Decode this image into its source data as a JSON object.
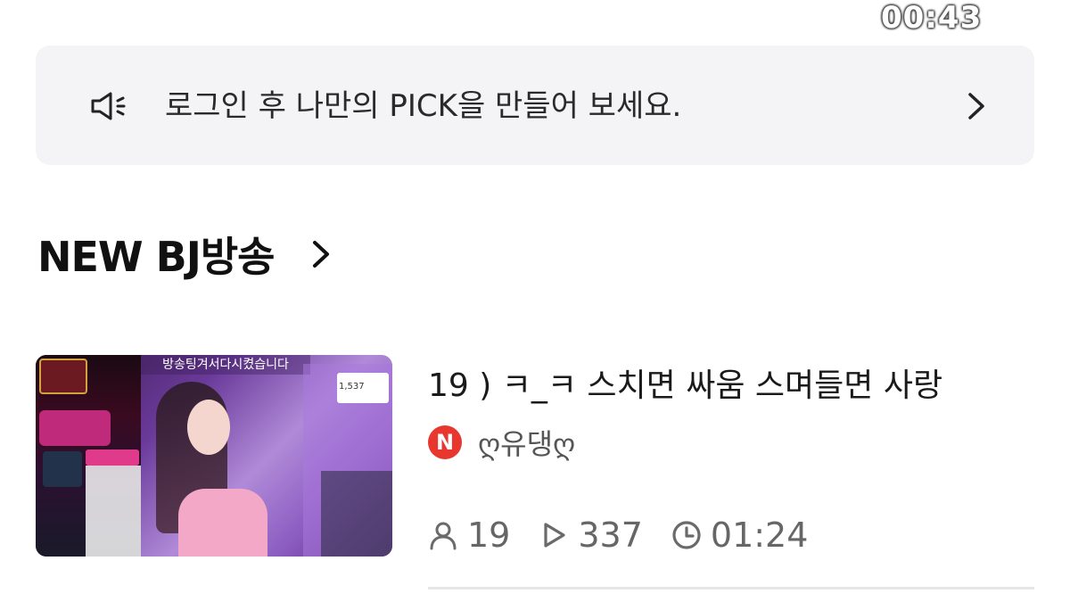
{
  "status": {
    "clock": "00:43"
  },
  "notice": {
    "text": "로그인 후 나만의 PICK을 만들어 보세요."
  },
  "section": {
    "title": "NEW BJ방송"
  },
  "broadcast": {
    "thumbnail_banner": "방송팅겨서다시켰습니다",
    "thumbnail_viewer_count": "1,537",
    "title": "19 ) ㅋ_ㅋ 스치면 싸움 스며들면 사랑",
    "author_badge": "N",
    "author": "ღ유댕ღ",
    "viewers": "19",
    "plays": "337",
    "duration": "01:24"
  },
  "icons": {
    "notice": "speaker-icon",
    "notice_arrow": "chevron-right-icon",
    "section_arrow": "chevron-right-icon",
    "viewers": "person-icon",
    "plays": "play-icon",
    "duration": "clock-icon"
  },
  "colors": {
    "badge": "#e8372f",
    "notice_bg": "#f4f4f6"
  }
}
